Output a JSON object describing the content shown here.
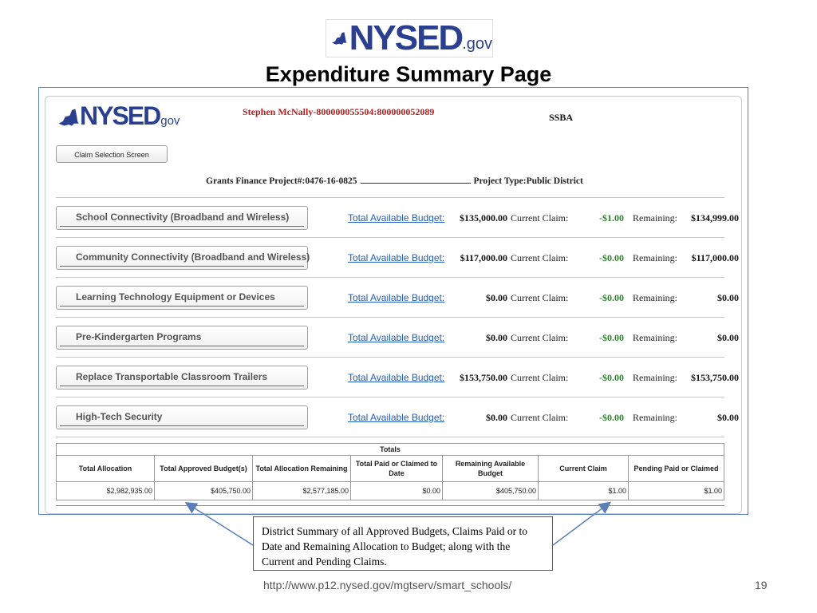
{
  "logo": {
    "brand": "NYSED",
    "suffix": ".gov"
  },
  "slide": {
    "title": "Expenditure Summary Page",
    "url": "http://www.p12.nysed.gov/mgtserv/smart_schools/",
    "page_number": "19"
  },
  "app": {
    "logo": {
      "brand": "NYSED",
      "suffix": "gov"
    },
    "user": "Stephen McNally-800000055504:800000052089",
    "program": "SSBA",
    "claim_selection_button": "Claim Selection Screen",
    "project_number": "Grants Finance Project#:0476-16-0825",
    "project_type": "Project Type:Public District",
    "labels": {
      "budget": "Total Available Budget:",
      "current": "Current Claim:",
      "remaining": "Remaining:"
    },
    "categories": [
      {
        "name": "School Connectivity (Broadband and Wireless)",
        "budget": "$135,000.00",
        "current": "-$1.00",
        "remaining": "$134,999.00"
      },
      {
        "name": "Community Connectivity (Broadband and Wireless)",
        "budget": "$117,000.00",
        "current": "-$0.00",
        "remaining": "$117,000.00"
      },
      {
        "name": "Learning Technology Equipment or Devices",
        "budget": "$0.00",
        "current": "-$0.00",
        "remaining": "$0.00"
      },
      {
        "name": "Pre-Kindergarten Programs",
        "budget": "$0.00",
        "current": "-$0.00",
        "remaining": "$0.00"
      },
      {
        "name": "Replace Transportable Classroom Trailers",
        "budget": "$153,750.00",
        "current": "-$0.00",
        "remaining": "$153,750.00"
      },
      {
        "name": "High-Tech Security",
        "budget": "$0.00",
        "current": "-$0.00",
        "remaining": "$0.00"
      }
    ],
    "totals": {
      "caption": "Totals",
      "headers": [
        "Total Allocation",
        "Total Approved Budget(s)",
        "Total Allocation Remaining",
        "Total Paid or Claimed to Date",
        "Remaining Available Budget",
        "Current Claim",
        "Pending Paid or Claimed"
      ],
      "values": [
        "$2,982,935.00",
        "$405,750.00",
        "$2,577,185.00",
        "$0.00",
        "$405,750.00",
        "$1.00",
        "$1.00"
      ]
    }
  },
  "callout": {
    "text": "District Summary of all Approved Budgets, Claims Paid or to Date and Remaining Allocation to Budget; along with the Current and Pending Claims."
  }
}
